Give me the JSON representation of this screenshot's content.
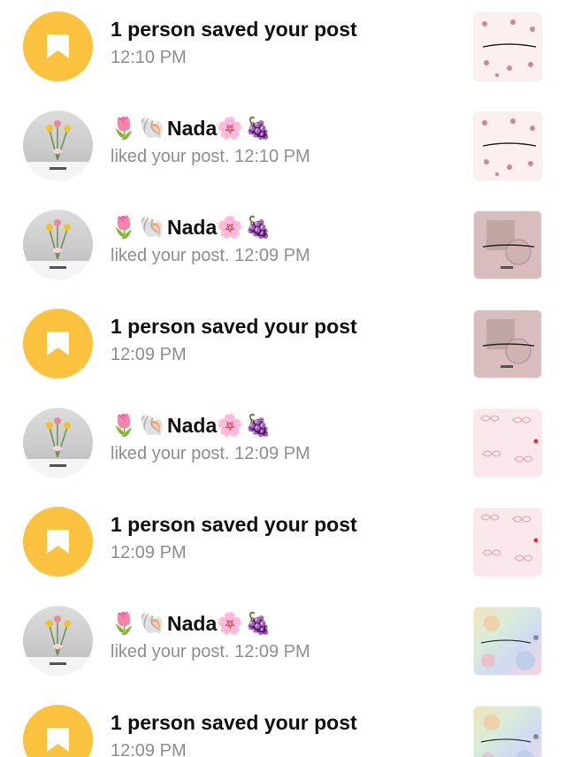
{
  "notifications": [
    {
      "kind": "saved",
      "title": "1 person saved your post",
      "time": "12:10 PM",
      "thumbnail": "pink-flower-pattern"
    },
    {
      "kind": "like",
      "user_name": "Nada",
      "emoji_before": [
        "🌷",
        "🐚"
      ],
      "emoji_after": [
        "🌸",
        "🍇"
      ],
      "action": "liked your post.",
      "time": "12:10 PM",
      "thumbnail": "pink-flower-pattern"
    },
    {
      "kind": "like",
      "user_name": "Nada",
      "emoji_before": [
        "🌷",
        "🐚"
      ],
      "emoji_after": [
        "🌸",
        "🍇"
      ],
      "action": "liked your post.",
      "time": "12:09 PM",
      "thumbnail": "mauve-photo"
    },
    {
      "kind": "saved",
      "title": "1 person saved your post",
      "time": "12:09 PM",
      "thumbnail": "mauve-photo"
    },
    {
      "kind": "like",
      "user_name": "Nada",
      "emoji_before": [
        "🌷",
        "🐚"
      ],
      "emoji_after": [
        "🌸",
        "🍇"
      ],
      "action": "liked your post.",
      "time": "12:09 PM",
      "thumbnail": "pink-bow-pattern"
    },
    {
      "kind": "saved",
      "title": "1 person saved your post",
      "time": "12:09 PM",
      "thumbnail": "pink-bow-pattern"
    },
    {
      "kind": "like",
      "user_name": "Nada",
      "emoji_before": [
        "🌷",
        "🐚"
      ],
      "emoji_after": [
        "🌸",
        "🍇"
      ],
      "action": "liked your post.",
      "time": "12:09 PM",
      "thumbnail": "pastel-floral"
    },
    {
      "kind": "saved",
      "title": "1 person saved your post",
      "time": "12:09 PM",
      "thumbnail": "pastel-floral"
    }
  ],
  "colors": {
    "saved_badge": "#fbc23f",
    "primary_text": "#111111",
    "secondary_text": "#8e8e93"
  }
}
